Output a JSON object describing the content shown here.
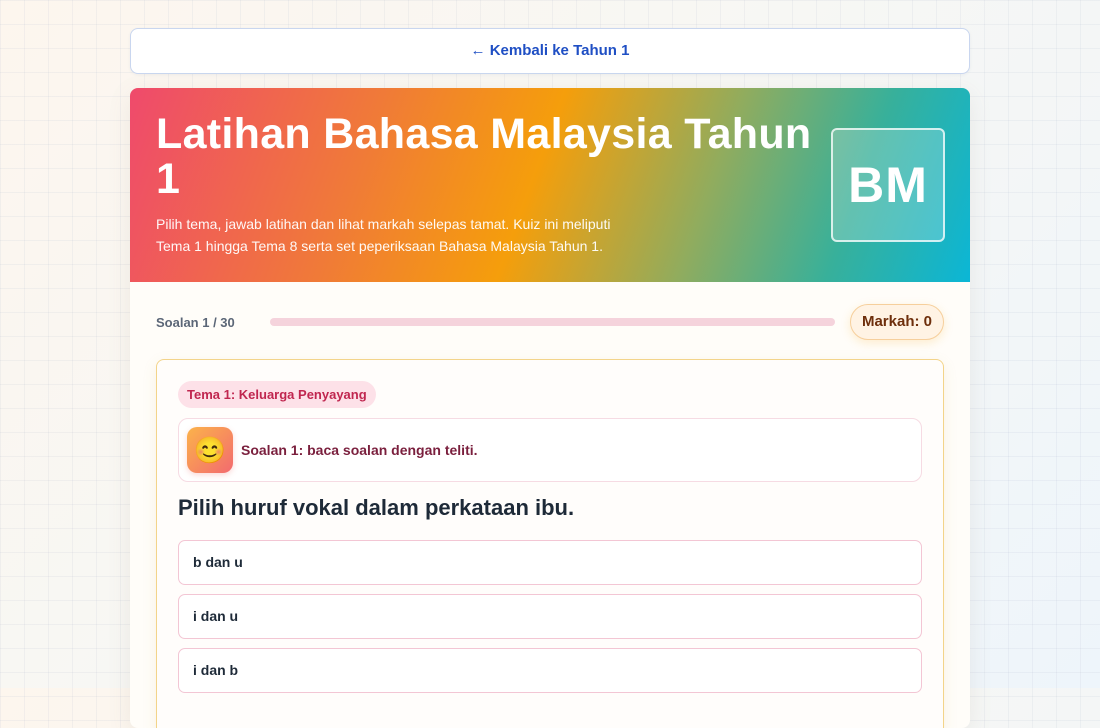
{
  "nav": {
    "back_label": "← Kembali ke Tahun 1"
  },
  "hero": {
    "title": "Latihan Bahasa Malaysia Tahun 1",
    "description": "Pilih tema, jawab latihan dan lihat markah selepas tamat. Kuiz ini meliputi Tema 1 hingga Tema 8 serta set peperiksaan Bahasa Malaysia Tahun 1.",
    "badge": "BM"
  },
  "progress": {
    "counter": "Soalan 1 / 30",
    "fraction": 0,
    "score_label": "Markah: 0"
  },
  "question": {
    "theme_tag": "Tema 1: Keluarga Penyayang",
    "hint_icon": "😊",
    "hint_text": "Soalan 1: baca soalan dengan teliti.",
    "text": "Pilih huruf vokal dalam perkataan ibu.",
    "options": [
      "b dan u",
      "i dan u",
      "i dan b"
    ]
  },
  "colors": {
    "accent_pink": "#ef4a6c",
    "accent_orange": "#f59e0b",
    "accent_teal": "#0bb6d6",
    "link_blue": "#1f4fc4"
  },
  "icons": {
    "hint": "smiling-face-icon",
    "back": "arrow-left-icon"
  }
}
